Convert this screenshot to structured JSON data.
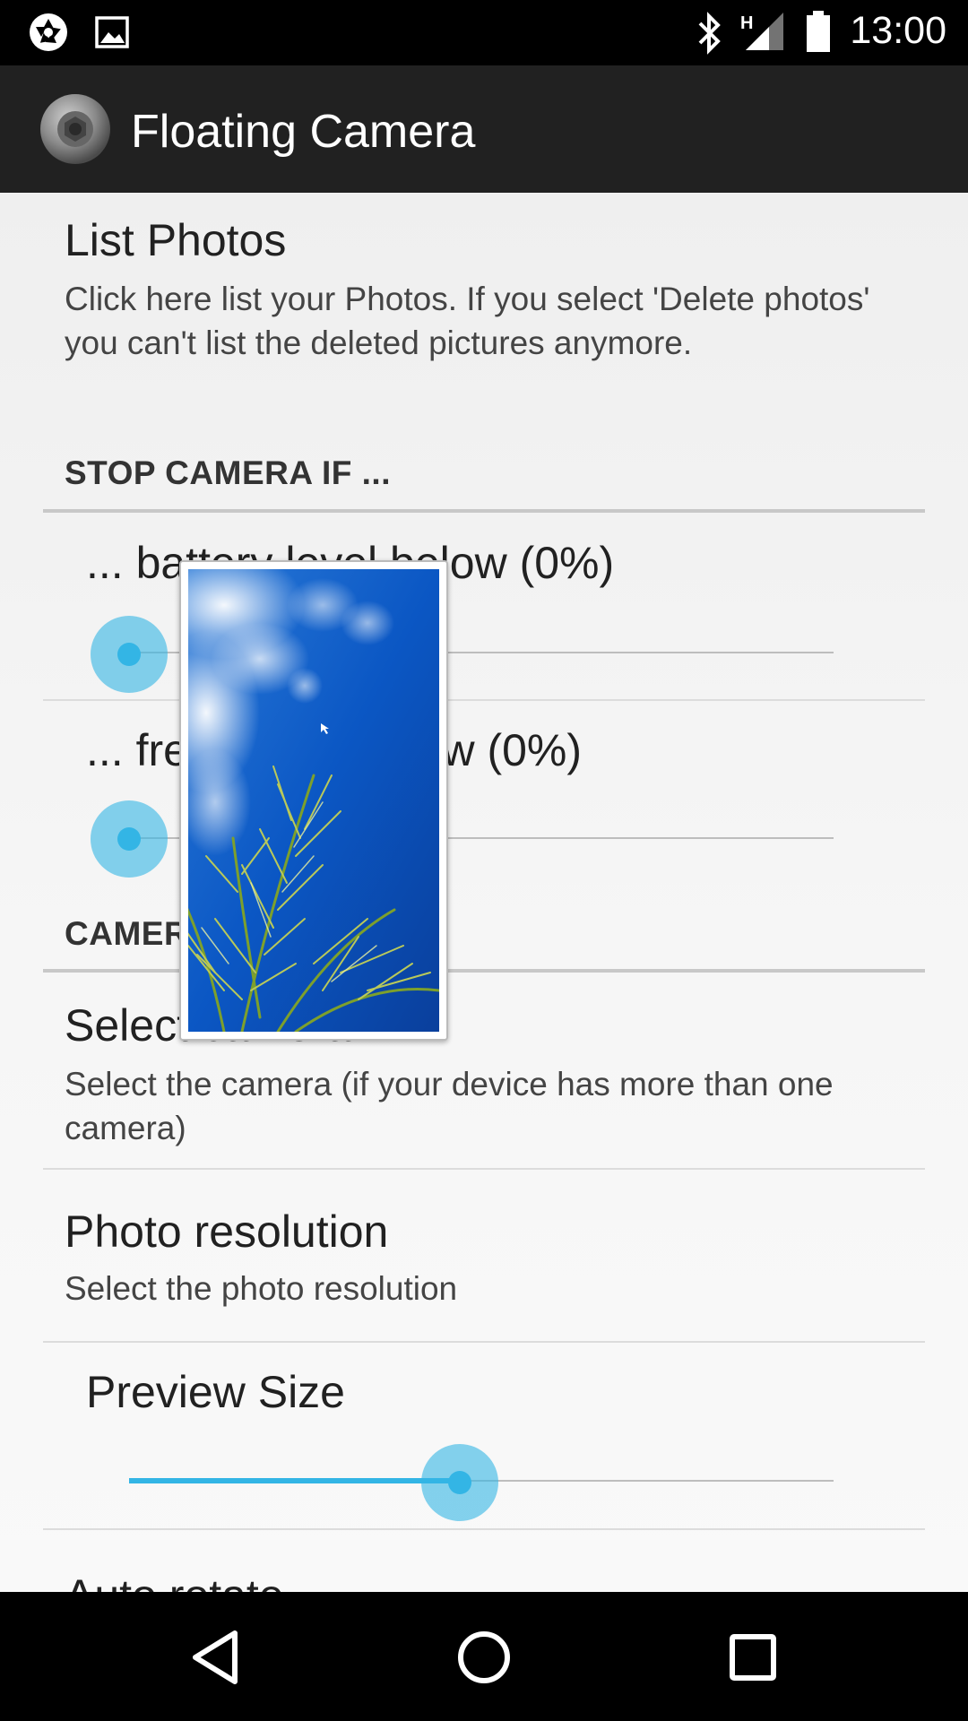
{
  "status_bar": {
    "time": "13:00",
    "left_icons": [
      "aperture-icon",
      "image-icon"
    ],
    "right_icons": [
      "bluetooth-icon",
      "signal-h-icon",
      "battery-icon"
    ],
    "network_type": "H"
  },
  "app_bar": {
    "title": "Floating Camera",
    "icon": "camera-lens-icon"
  },
  "preferences": {
    "list_photos": {
      "title": "List Photos",
      "summary": "Click here list your Photos. If you select 'Delete photos' you can't list the deleted pictures anymore."
    },
    "stop_category": {
      "title": "STOP CAMERA IF ..."
    },
    "battery_seek": {
      "label": "... battery level below (0%)",
      "value_percent": 0
    },
    "free_space_seek": {
      "label": "... free space below (0%)",
      "value_percent": 0
    },
    "camera_category": {
      "title": "CAMERA"
    },
    "select_camera": {
      "title": "Select camera",
      "summary": "Select the camera (if your device has more than one camera)"
    },
    "photo_resolution": {
      "title": "Photo resolution",
      "summary": "Select the photo resolution"
    },
    "preview_size": {
      "title": "Preview Size",
      "value_fraction": 0.47
    },
    "auto_rotate": {
      "title": "Auto rotate"
    }
  },
  "floating_preview": {
    "content": "camera-preview-image"
  },
  "nav_bar": {
    "buttons": [
      "back-icon",
      "home-icon",
      "recents-icon"
    ]
  },
  "colors": {
    "accent": "#33b5e5",
    "status_bar": "#000000",
    "app_bar": "#212121",
    "background": "#f3f3f3"
  }
}
